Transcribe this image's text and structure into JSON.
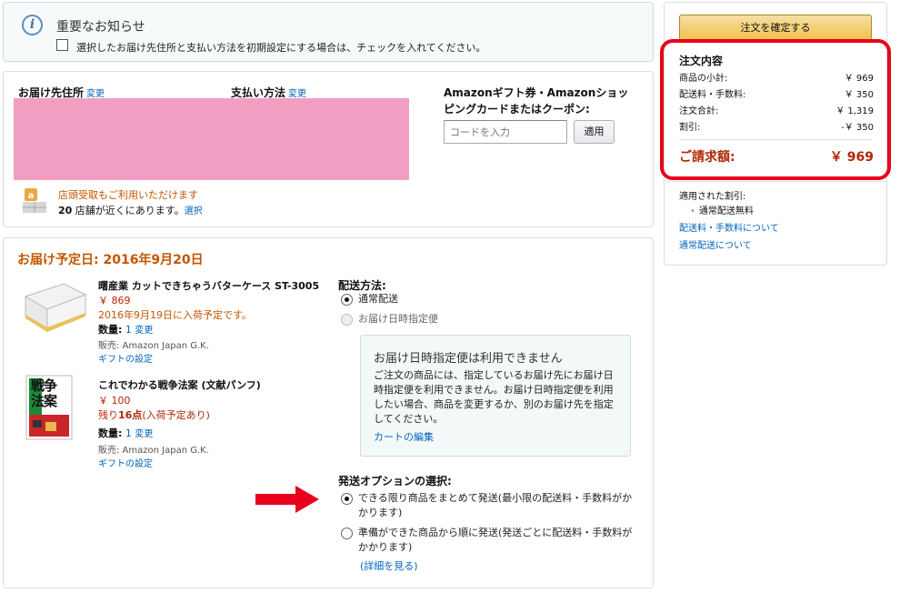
{
  "notice": {
    "title": "重要なお知らせ",
    "checkbox_label": "選択したお届け先住所と支払い方法を初期設定にする場合は、チェックを入れてください。"
  },
  "address_section": {
    "address_label": "お届け先住所",
    "address_change": "変更",
    "payment_label": "支払い方法",
    "payment_change": "変更",
    "pickup_text": "店頭受取もご利用いただけます",
    "store_count": "20",
    "store_suffix": " 店舗が近くにあります。",
    "store_select": "選択",
    "coupon_title": "Amazonギフト券・Amazonショッピングカードまたはクーポン:",
    "coupon_placeholder": "コードを入力",
    "apply_button": "適用"
  },
  "shipment": {
    "date_label": "お届け予定日: 2016年9月20日",
    "items": [
      {
        "title": "曙産業 カットできちゃうバターケース ST-3005",
        "price": "￥ 869",
        "availability": "2016年9月19日に入荷予定です。",
        "qty_label": "数量:",
        "qty_value": "1",
        "qty_change": "変更",
        "seller": "販売: Amazon Japan G.K.",
        "gift": "ギフトの設定"
      },
      {
        "title": "これでわかる戦争法案 (文献パンフ)",
        "price": "￥ 100",
        "availability_prefix": "残り",
        "availability_count": "16点",
        "availability_suffix": "(入荷予定あり)",
        "qty_label": "数量:",
        "qty_value": "1",
        "qty_change": "変更",
        "seller": "販売: Amazon Japan G.K.",
        "gift": "ギフトの設定",
        "cover_text": "戦争法案"
      }
    ],
    "method_title": "配送方法:",
    "method_options": [
      "通常配送",
      "お届け日時指定便"
    ],
    "unavailable": {
      "title": "お届け日時指定便は利用できません",
      "body": "ご注文の商品には、指定しているお届け先にお届け日時指定便を利用できません。お届け日時指定便を利用したい場合、商品を変更するか、別のお届け先を指定してください。",
      "link": "カートの編集"
    },
    "option_title": "発送オプションの選択:",
    "options": [
      "できる限り商品をまとめて発送(最小限の配送料・手数料がかかります)",
      "準備ができた商品から順に発送(発送ごとに配送料・手数料がかかります)"
    ],
    "details_link": "(詳細を見る)"
  },
  "summary": {
    "place_order": "注文を確定する",
    "title": "注文内容",
    "rows": [
      {
        "label": "商品の小計:",
        "value": "￥ 969"
      },
      {
        "label": "配送料・手数料:",
        "value": "￥ 350"
      },
      {
        "label": "注文合計:",
        "value": "￥ 1,319"
      },
      {
        "label": "割引:",
        "value": "-￥ 350"
      }
    ],
    "total_label": "ご請求額:",
    "total_value": "￥ 969",
    "applied_title": "適用された割引:",
    "applied_item": "通常配送無料",
    "link1": "配送料・手数料について",
    "link2": "通常配送について"
  },
  "colors": {
    "accent_orange": "#c45500",
    "price_red": "#b12704",
    "link_blue": "#0066c0",
    "highlight_red": "#e8001c",
    "redaction_pink": "#f19ec2"
  }
}
